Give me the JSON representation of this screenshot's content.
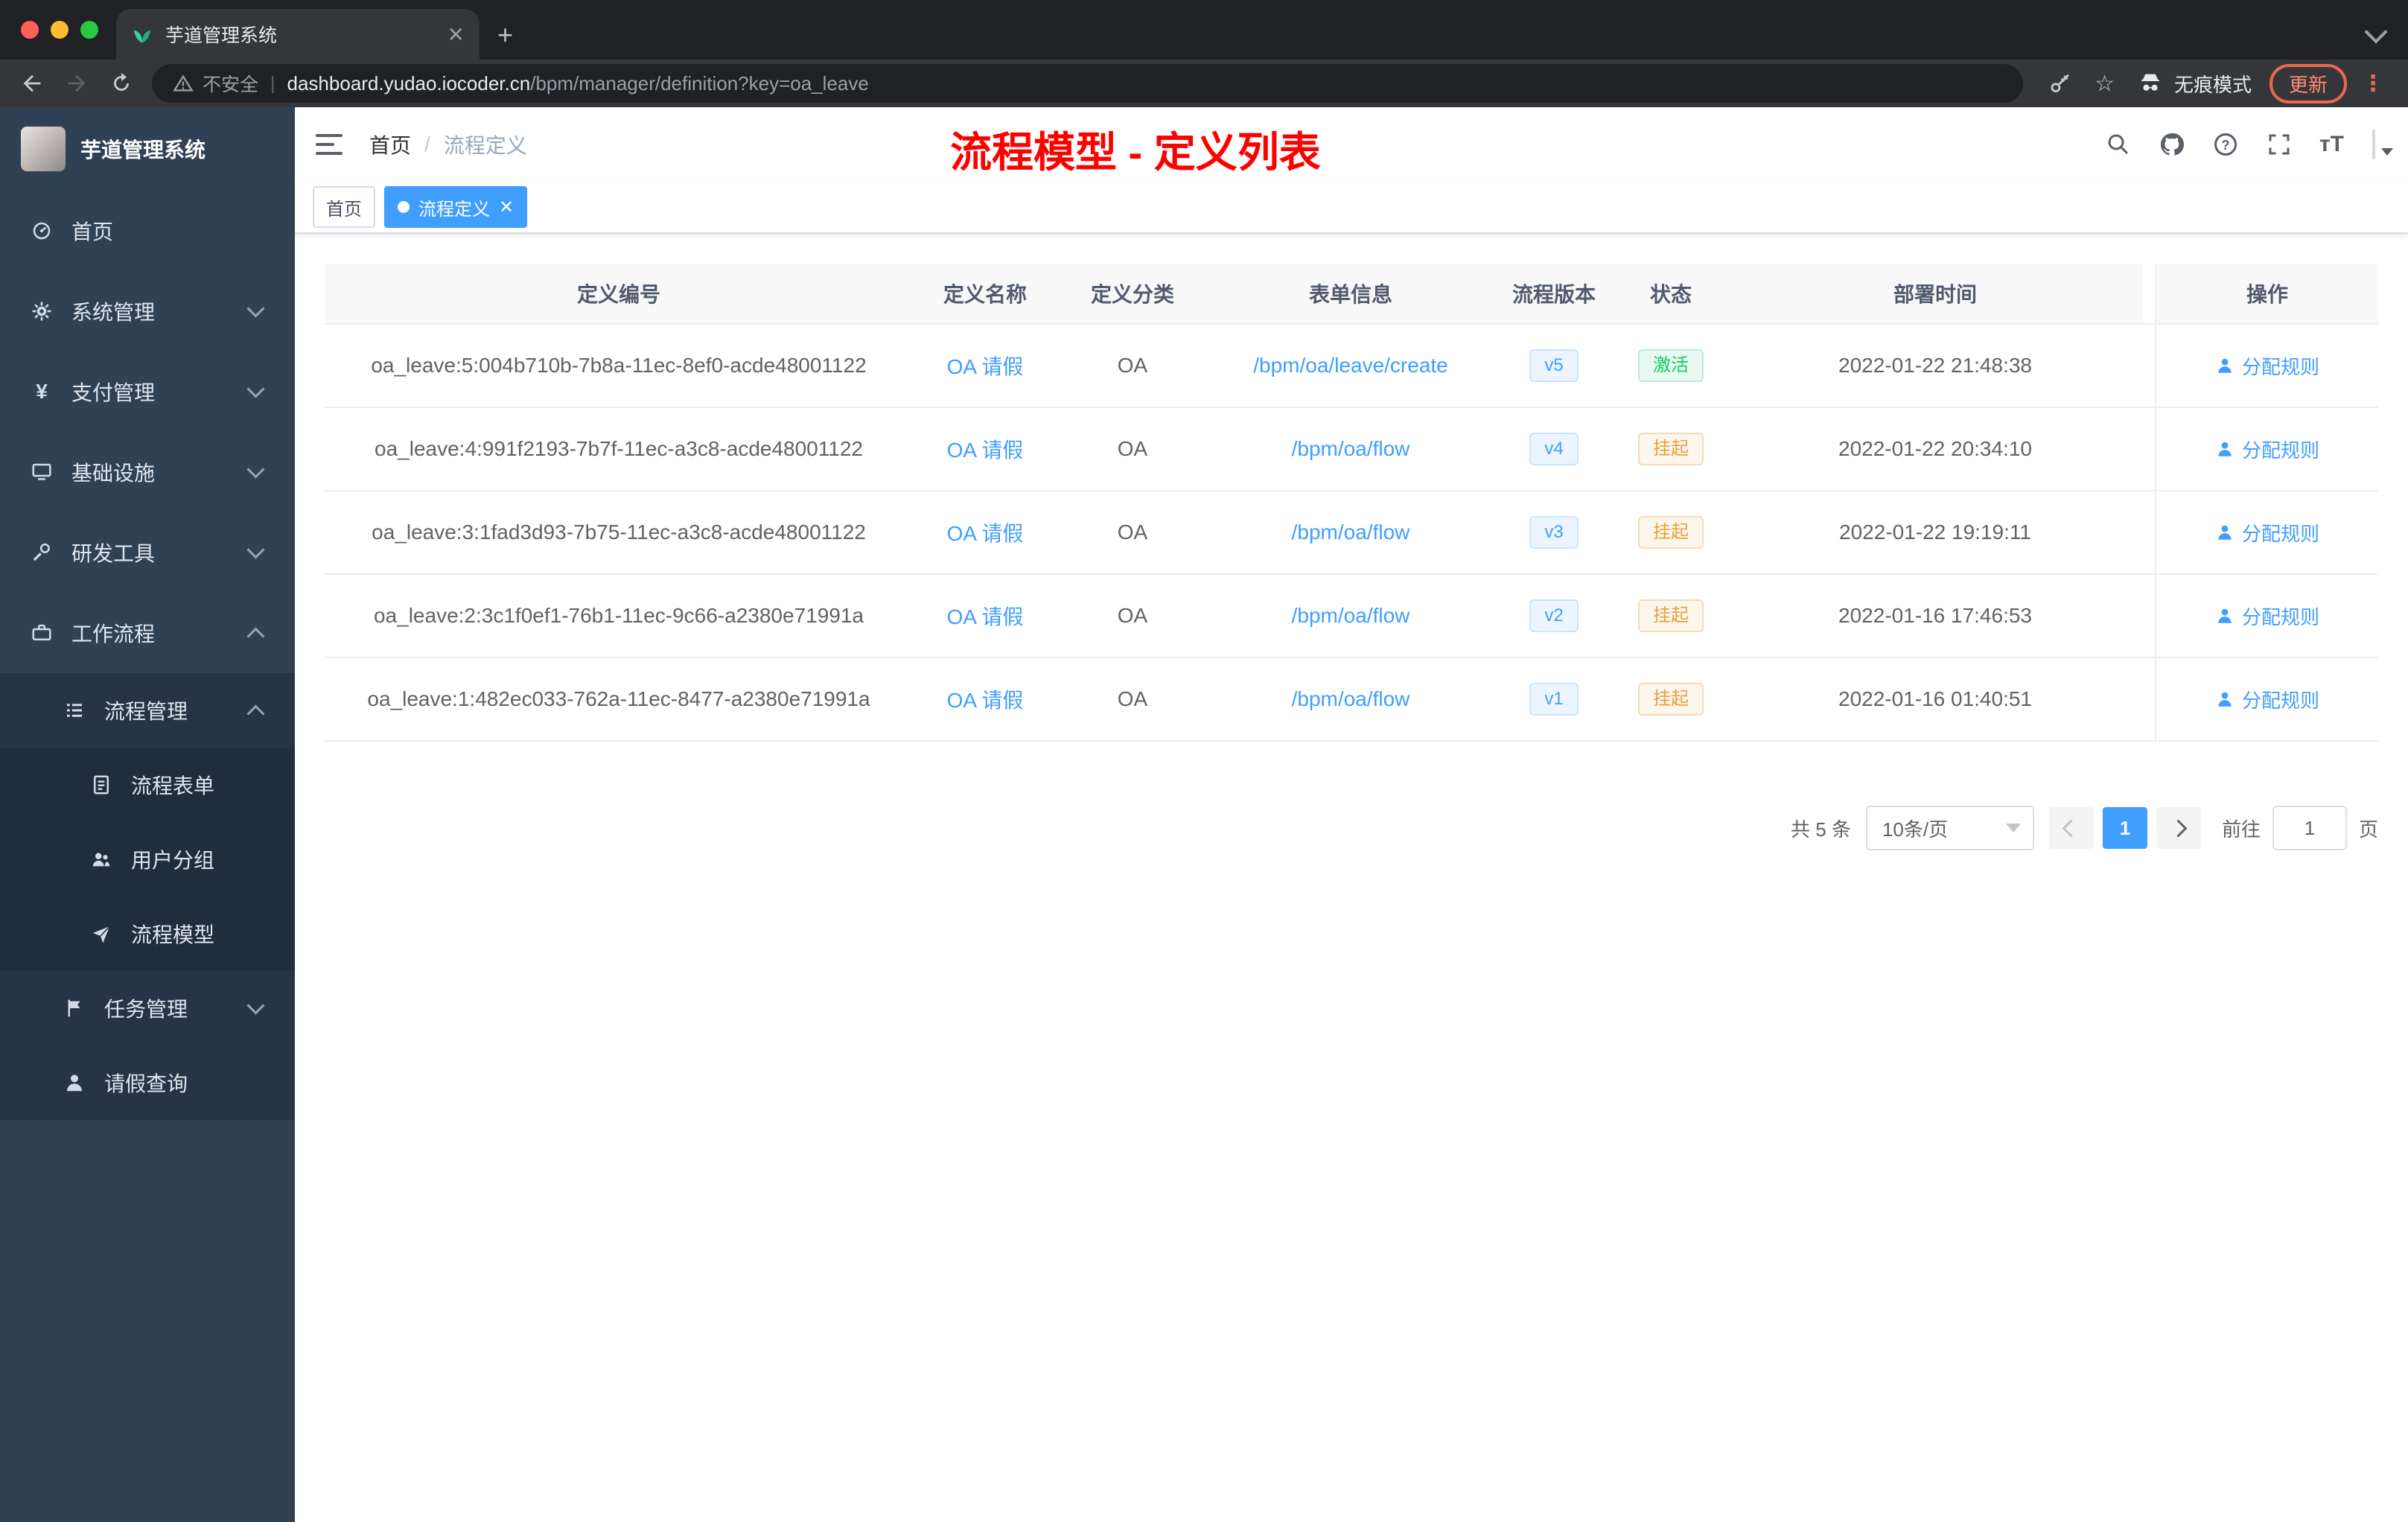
{
  "browser": {
    "tab": {
      "title": "芋道管理系统"
    },
    "address": {
      "security": "不安全",
      "host": "dashboard.yudao.iocoder.cn",
      "path": "/bpm/manager/definition?key=oa_leave"
    },
    "incognito": "无痕模式",
    "update": "更新"
  },
  "sidebar": {
    "logo": "芋道管理系统",
    "items": [
      {
        "key": "home",
        "label": "首页",
        "icon": "dashboard-icon",
        "level": 1
      },
      {
        "key": "system",
        "label": "系统管理",
        "icon": "gear-icon",
        "level": 1,
        "chevron": "down"
      },
      {
        "key": "payment",
        "label": "支付管理",
        "icon": "payment-icon",
        "level": 1,
        "chevron": "down"
      },
      {
        "key": "infrastructure",
        "label": "基础设施",
        "icon": "infrastructure-icon",
        "level": 1,
        "chevron": "down"
      },
      {
        "key": "devtools",
        "label": "研发工具",
        "icon": "tools-icon",
        "level": 1,
        "chevron": "down"
      },
      {
        "key": "workflow",
        "label": "工作流程",
        "icon": "workflow-icon",
        "level": 1,
        "chevron": "up"
      },
      {
        "key": "process-management",
        "label": "流程管理",
        "icon": "process-icon",
        "level": 2,
        "chevron": "up"
      },
      {
        "key": "process-form",
        "label": "流程表单",
        "icon": "form-icon",
        "level": 3
      },
      {
        "key": "user-group",
        "label": "用户分组",
        "icon": "group-icon",
        "level": 3
      },
      {
        "key": "process-model",
        "label": "流程模型",
        "icon": "model-icon",
        "level": 3
      },
      {
        "key": "task-management",
        "label": "任务管理",
        "icon": "task-icon",
        "level": 2,
        "chevron": "down"
      },
      {
        "key": "leave-query",
        "label": "请假查询",
        "icon": "leave-icon",
        "level": 2
      }
    ]
  },
  "header": {
    "breadcrumb": [
      "首页",
      "流程定义"
    ],
    "separator": "/",
    "annotation": "流程模型 - 定义列表"
  },
  "tags": [
    {
      "label": "首页",
      "active": false
    },
    {
      "label": "流程定义",
      "active": true
    }
  ],
  "table": {
    "columns": [
      "定义编号",
      "定义名称",
      "定义分类",
      "表单信息",
      "流程版本",
      "状态",
      "部署时间",
      "操作"
    ],
    "action_label": "分配规则",
    "rows": [
      {
        "id": "oa_leave:5:004b710b-7b8a-11ec-8ef0-acde48001122",
        "name": "OA 请假",
        "category": "OA",
        "form": "/bpm/oa/leave/create",
        "version": "v5",
        "status": "激活",
        "status_type": "success",
        "deployed_at": "2022-01-22 21:48:38"
      },
      {
        "id": "oa_leave:4:991f2193-7b7f-11ec-a3c8-acde48001122",
        "name": "OA 请假",
        "category": "OA",
        "form": "/bpm/oa/flow",
        "version": "v4",
        "status": "挂起",
        "status_type": "warning",
        "deployed_at": "2022-01-22 20:34:10"
      },
      {
        "id": "oa_leave:3:1fad3d93-7b75-11ec-a3c8-acde48001122",
        "name": "OA 请假",
        "category": "OA",
        "form": "/bpm/oa/flow",
        "version": "v3",
        "status": "挂起",
        "status_type": "warning",
        "deployed_at": "2022-01-22 19:19:11"
      },
      {
        "id": "oa_leave:2:3c1f0ef1-76b1-11ec-9c66-a2380e71991a",
        "name": "OA 请假",
        "category": "OA",
        "form": "/bpm/oa/flow",
        "version": "v2",
        "status": "挂起",
        "status_type": "warning",
        "deployed_at": "2022-01-16 17:46:53"
      },
      {
        "id": "oa_leave:1:482ec033-762a-11ec-8477-a2380e71991a",
        "name": "OA 请假",
        "category": "OA",
        "form": "/bpm/oa/flow",
        "version": "v1",
        "status": "挂起",
        "status_type": "warning",
        "deployed_at": "2022-01-16 01:40:51"
      }
    ]
  },
  "pagination": {
    "total": "共 5 条",
    "page_size": "10条/页",
    "current": "1",
    "goto_label": "前往",
    "goto_value": "1",
    "goto_unit": "页"
  },
  "colors": {
    "accent": "#409eff",
    "success": "#13ce66",
    "warning": "#e6a23c",
    "sidebar": "#304156",
    "annotation": "#ff0000"
  }
}
